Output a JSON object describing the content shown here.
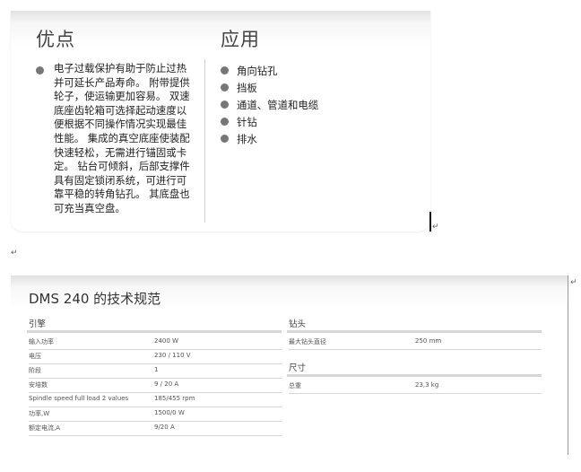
{
  "advantages": {
    "heading": "优点",
    "text": "电子过载保护有助于防止过热并可延长产品寿命。 附带提供轮子，使运输更加容易。 双速底座齿轮箱可选择起动速度以便根据不同操作情况实现最佳性能。 集成的真空底座使装配快速轻松，无需进行锚固或卡定。 钻台可倾斜，后部支撑件具有固定锁闭系统，可进行可靠平稳的转角钻孔。 其底盘也可充当真空盘。"
  },
  "applications": {
    "heading": "应用",
    "items": [
      "角向钻孔",
      "挡板",
      "通道、管道和电缆",
      "针钻",
      "排水"
    ]
  },
  "paragraph_mark": "↵",
  "specs": {
    "title": "DMS 240 的技术规范",
    "engine": {
      "heading": "引擎",
      "rows": [
        {
          "label": "输入功率",
          "value": "2400 W"
        },
        {
          "label": "电压",
          "value": "230 / 110 V"
        },
        {
          "label": "阶段",
          "value": "1"
        },
        {
          "label": "安培数",
          "value": "9 / 20 A"
        },
        {
          "label": "Spindle speed full load 2 values",
          "value": "185/455 rpm"
        },
        {
          "label": "功率,W",
          "value": "1500/0 W"
        },
        {
          "label": "额定电流,A",
          "value": "9/20 A"
        }
      ]
    },
    "drill_bit": {
      "heading": "钻头",
      "rows": [
        {
          "label": "最大钻头直径",
          "value": "250 mm"
        }
      ]
    },
    "dimensions": {
      "heading": "尺寸",
      "rows": [
        {
          "label": "总重",
          "value": "23,3 kg"
        }
      ]
    }
  }
}
